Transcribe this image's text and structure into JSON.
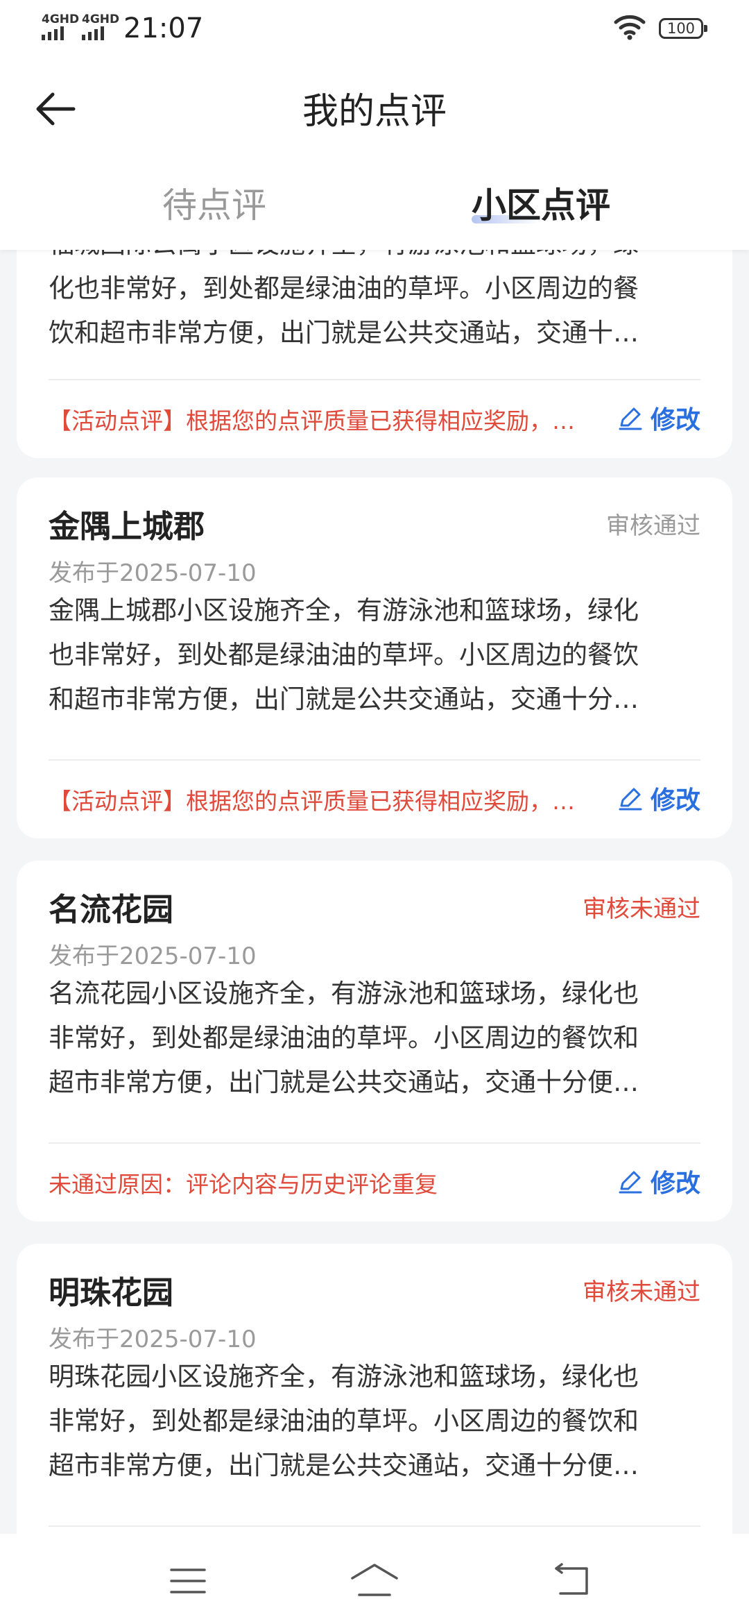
{
  "status_bar": {
    "signal1": "4GHD",
    "signal2": "4GHD",
    "time": "21:07",
    "battery": "100"
  },
  "header": {
    "title": "我的点评",
    "tabs": [
      {
        "label": "待点评",
        "active": false
      },
      {
        "label": "小区点评",
        "active": true
      }
    ]
  },
  "cards": [
    {
      "body": [
        "福城国际公寓小区设施齐全，有游泳池和篮球场，绿",
        "化也非常好，到处都是绿油油的草坪。小区周边的餐",
        "饮和超市非常方便，出门就是公共交通站，交通十…"
      ],
      "note": "【活动点评】根据您的点评质量已获得相应奖励，…",
      "edit": "修改"
    },
    {
      "title": "金隅上城郡",
      "status": "审核通过",
      "status_color": "#9a9a9a",
      "date": "发布于2025-07-10",
      "body": [
        "金隅上城郡小区设施齐全，有游泳池和篮球场，绿化",
        "也非常好，到处都是绿油油的草坪。小区周边的餐饮",
        "和超市非常方便，出门就是公共交通站，交通十分…"
      ],
      "note": "【活动点评】根据您的点评质量已获得相应奖励，…",
      "edit": "修改"
    },
    {
      "title": "名流花园",
      "status": "审核未通过",
      "status_color": "#e04a3b",
      "date": "发布于2025-07-10",
      "body": [
        "名流花园小区设施齐全，有游泳池和篮球场，绿化也",
        "非常好，到处都是绿油油的草坪。小区周边的餐饮和",
        "超市非常方便，出门就是公共交通站，交通十分便…"
      ],
      "note": "未通过原因：评论内容与历史评论重复",
      "edit": "修改"
    },
    {
      "title": "明珠花园",
      "status": "审核未通过",
      "status_color": "#e04a3b",
      "date": "发布于2025-07-10",
      "body": [
        "明珠花园小区设施齐全，有游泳池和篮球场，绿化也",
        "非常好，到处都是绿油油的草坪。小区周边的餐饮和",
        "超市非常方便，出门就是公共交通站，交通十分便…"
      ]
    }
  ]
}
